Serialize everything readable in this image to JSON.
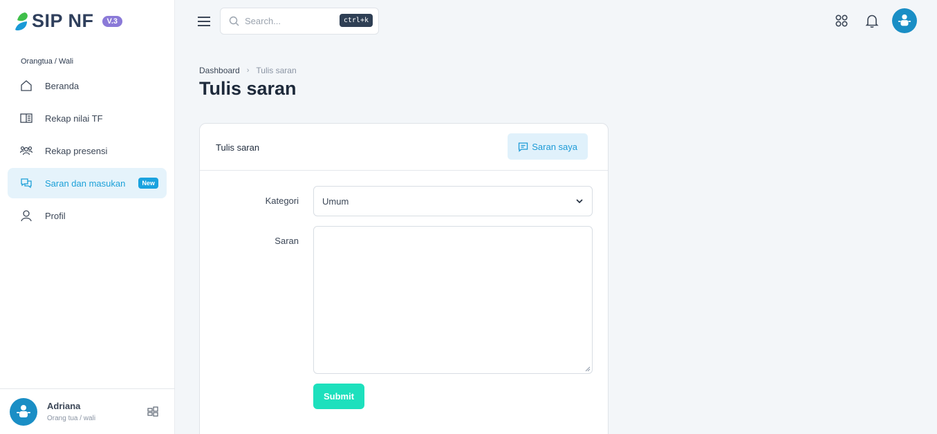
{
  "app": {
    "name": "SIP NF",
    "version": "V.3"
  },
  "sidebar": {
    "section_label": "Orangtua / Wali",
    "items": [
      {
        "label": "Beranda",
        "icon": "home-icon"
      },
      {
        "label": "Rekap nilai TF",
        "icon": "book-icon"
      },
      {
        "label": "Rekap presensi",
        "icon": "users-icon"
      },
      {
        "label": "Saran dan masukan",
        "icon": "chat-icon",
        "badge": "New",
        "active": true
      },
      {
        "label": "Profil",
        "icon": "user-icon"
      }
    ],
    "user": {
      "name": "Adriana",
      "role": "Orang tua / wali"
    }
  },
  "topbar": {
    "search_placeholder": "Search...",
    "shortcut": "ctrl+k"
  },
  "breadcrumb": {
    "home": "Dashboard",
    "current": "Tulis saran"
  },
  "page_title": "Tulis saran",
  "card": {
    "title": "Tulis saran",
    "saran_saya_label": "Saran saya",
    "kategori_label": "Kategori",
    "kategori_value": "Umum",
    "saran_label": "Saran",
    "saran_value": "",
    "submit_label": "Submit"
  },
  "colors": {
    "accent": "#1ca0d8",
    "submit": "#1de0bd",
    "version_badge": "#8b7ad8"
  }
}
